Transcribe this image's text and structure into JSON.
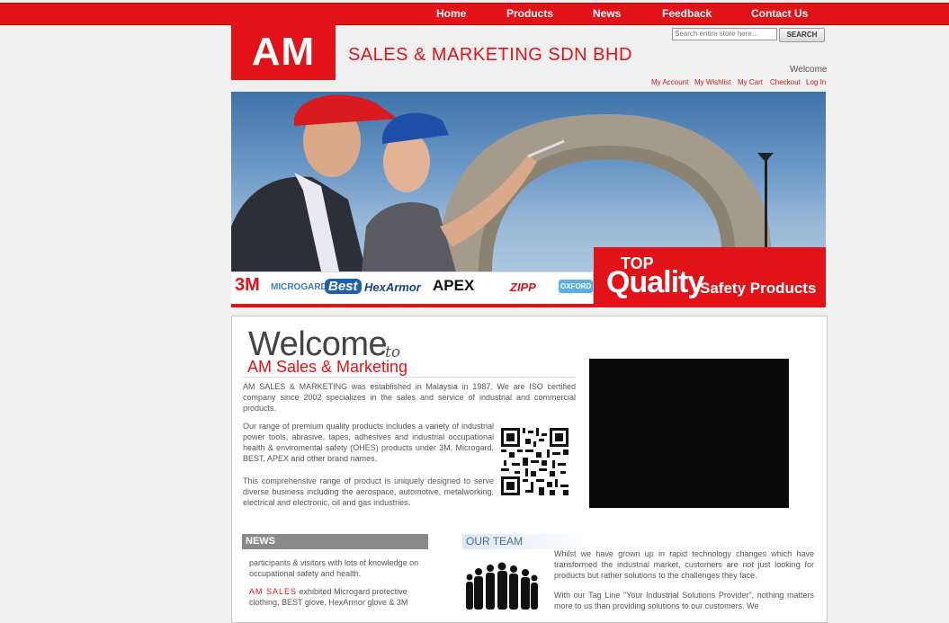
{
  "nav": {
    "items": [
      "Home",
      "Products",
      "News",
      "Feedback",
      "Contact Us"
    ]
  },
  "header": {
    "logo_text": "AM",
    "company_name": "SALES & MARKETING SDN BHD",
    "search_placeholder": "Search entire store here...",
    "search_button": "SEARCH",
    "welcome": "Welcome",
    "account_links": [
      "My Account",
      "My Wishlist",
      "My Cart",
      "Checkout",
      "Log In"
    ]
  },
  "banner": {
    "brands": [
      "3M",
      "MICROGARD",
      "Best",
      "HexArmor",
      "APEX",
      "ZIPP",
      "OXFORD"
    ],
    "quality_top": "TOP",
    "quality_main": "Quality",
    "quality_sub": "Safety Products"
  },
  "intro": {
    "heading": "Welcome",
    "heading_to": "to",
    "subheading": "AM Sales & Marketing",
    "paragraph1": "AM SALES & MARKETING was established in Malaysia in 1987. We are ISO certified company since 2002 specializes in the sales and service of industrial and commercial products.",
    "paragraph2": "Our range of premium quality products includes a variety of industrial power tools, abrasive, tapes, adhesives and industrial occupational health & enviromental safety (OHES) products under 3M, Microgard, BEST, APEX and other brand names.",
    "paragraph3": "This comprehensive range of product is uniquely designed to serve diverse business including the aerospace, automotive, metalworking, electrical and electronic, oil and gas industries."
  },
  "news": {
    "title": "NEWS",
    "text1": "participants & visitors with lots of knowledge on occupational safety and health.",
    "text2_brand": "AM SALES",
    "text2": " exhibited Microgard protective clothing, BEST glove, HexArmor glove & 3M"
  },
  "team": {
    "title": "OUR TEAM",
    "paragraph1": "Whilst we have grown up in rapid technology changes which have transformed the industrial market, customers are not just looking for products but rather solutions to the challenges they face.",
    "paragraph2": "With our Tag Line \"Your Industrial Solutions Provider\", nothing matters more to us than providing solutions to our customers. We"
  },
  "colors": {
    "brand_red": "#e21219",
    "page_bg": "#f0f0f0"
  }
}
